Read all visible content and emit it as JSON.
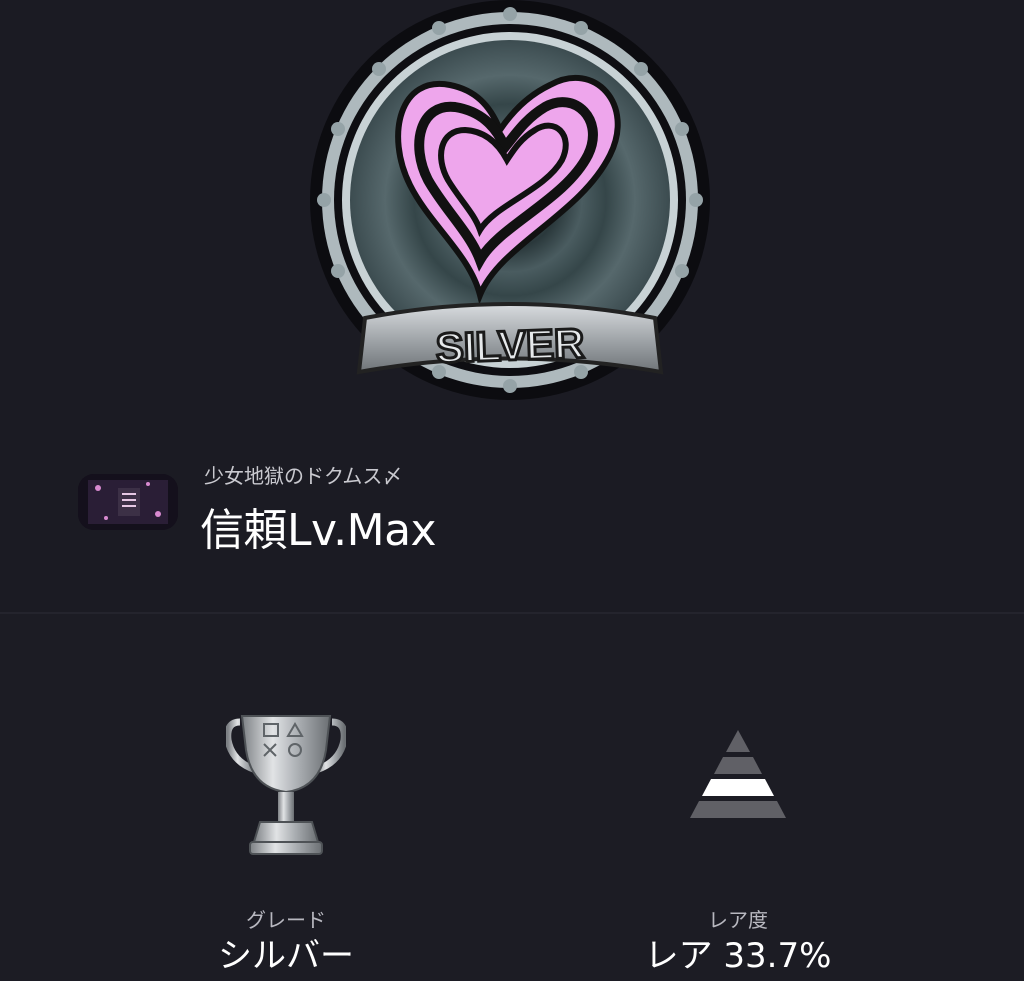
{
  "trophy": {
    "game_name": "少女地獄のドクムス〆",
    "title": "信頼Lv.Max",
    "badge_label": "SILVER",
    "badge_icon": "heart-silver-badge-icon"
  },
  "stats": {
    "grade": {
      "label": "グレード",
      "value": "シルバー",
      "icon": "silver-trophy-icon"
    },
    "rarity": {
      "label": "レア度",
      "value": "レア 33.7%",
      "icon": "rarity-pyramid-icon"
    }
  },
  "colors": {
    "background": "#1c1c24",
    "badge_pink": "#eea6ec",
    "silver": "#b5b9bd"
  }
}
